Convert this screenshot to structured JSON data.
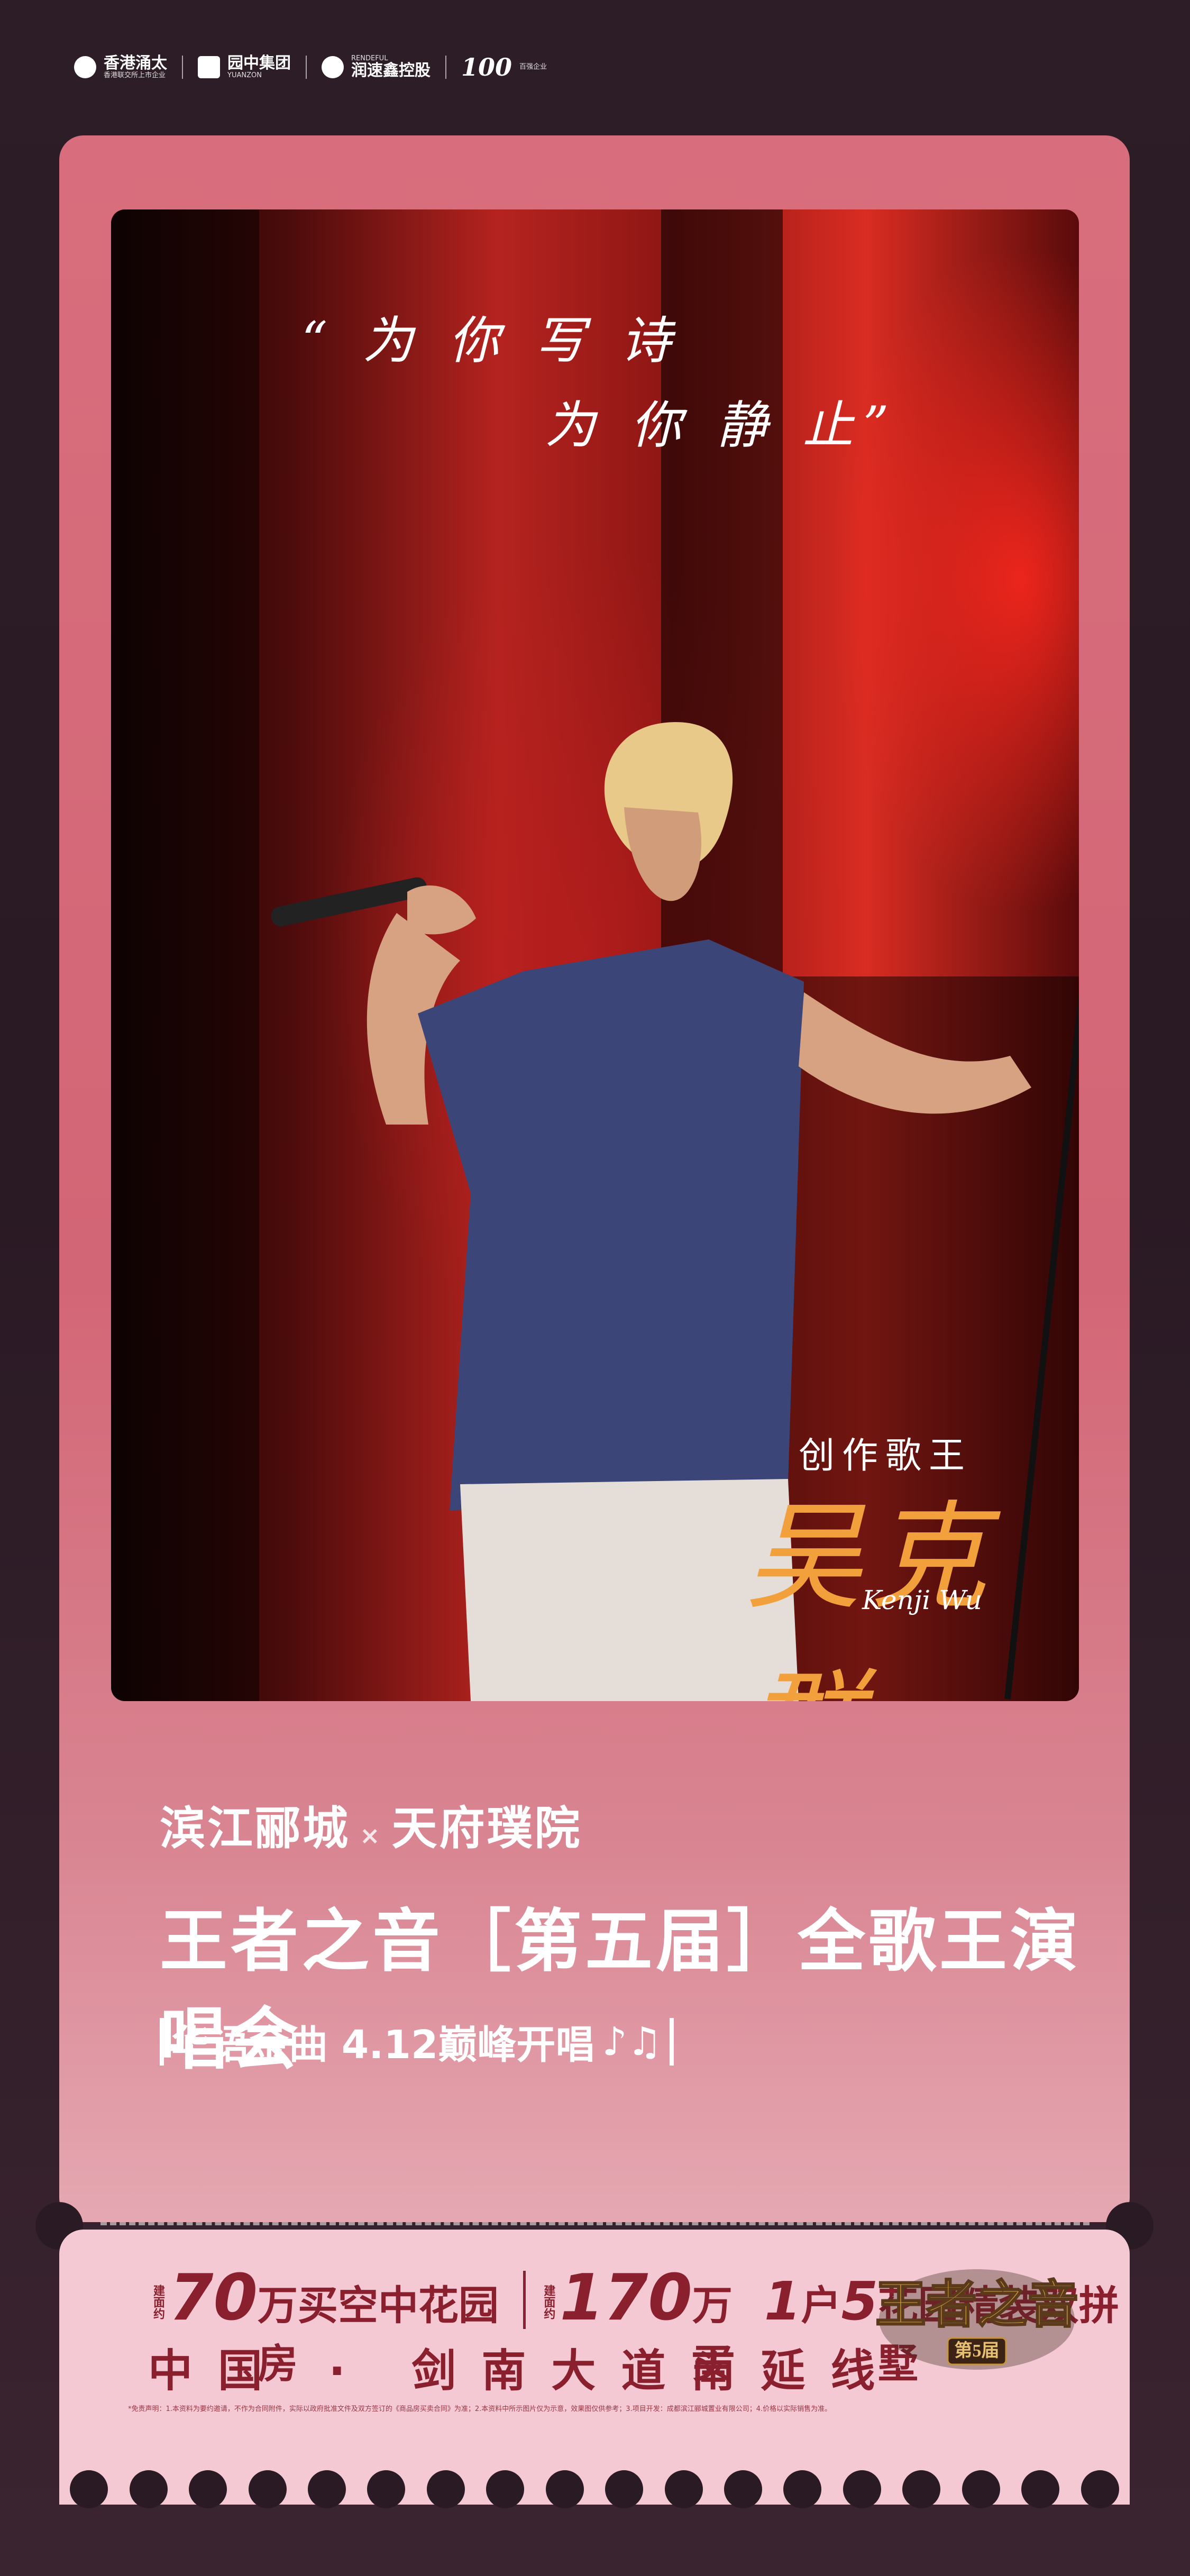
{
  "header": {
    "logos": [
      {
        "name": "香港涌太",
        "sub": "香港联交所上市企业"
      },
      {
        "name": "园中集团",
        "sub": "YUANZON"
      },
      {
        "name": "润速鑫控股",
        "sub": "RENDEFUL"
      },
      {
        "name": "100",
        "sub": "百强企业"
      }
    ]
  },
  "poster": {
    "quote_line1": "“ 为 你 写 诗",
    "quote_line2": "为 你 静 止”",
    "caption_title": "创作歌王",
    "caption_name": "吴克群",
    "caption_en": "Kenji Wu",
    "project_a": "滨江郦城",
    "project_x": "×",
    "project_b": "天府璞院",
    "event_title": "王者之音［第五届］全歌王演唱会",
    "subtitle": "华语金曲 4.12巅峰开唱",
    "subtitle_notes": "♪♫"
  },
  "stub": {
    "promo1_value": "70",
    "promo1_unit": "万买空中花园房",
    "promo1_tiny": "建面约",
    "promo2_value": "170",
    "promo2_unit": "万买",
    "promo2_mid": "1",
    "promo2_unit2": "户",
    "promo2_mid2": "5",
    "promo2_unit3": "花园精装双拼墅",
    "promo2_tiny": "建面约",
    "road": "中国 · 剑南大道南延线",
    "event_logo_text": "王者之音",
    "event_logo_badge": "第5届",
    "fine_print": "*免责声明：1.本资料为要约邀请，不作为合同附件，实际以政府批准文件及双方签订的《商品房买卖合同》为准；2.本资料中所示图片仅为示意，效果图仅供参考；3.项目开发：成都滨江郦城置业有限公司；4.价格以实际销售为准。"
  },
  "colors": {
    "ticket": "#d36676",
    "stub": "#f4c9d3",
    "accent_text": "#8a1f2e",
    "name_gold": "#f2a03c",
    "background": "#2a1a24"
  }
}
